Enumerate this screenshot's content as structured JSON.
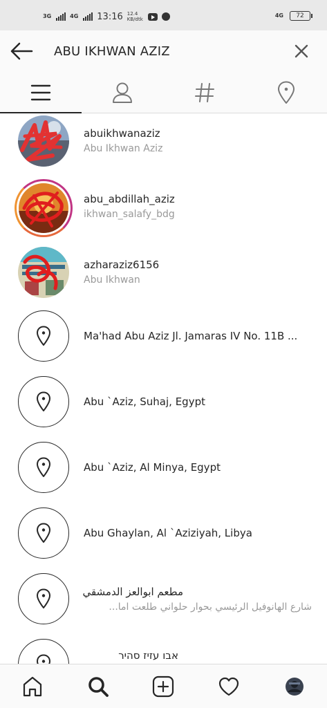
{
  "status_bar": {
    "network_1": "3G",
    "network_2": "4G",
    "time": "13:16",
    "speed": "12.4 KB/dtk",
    "network_right": "4G",
    "battery": "72"
  },
  "search": {
    "query": "ABU IKHWAN AZIZ"
  },
  "tabs": [
    {
      "name": "top",
      "icon": "list-icon"
    },
    {
      "name": "accounts",
      "icon": "person-icon"
    },
    {
      "name": "tags",
      "icon": "hashtag-icon"
    },
    {
      "name": "places",
      "icon": "location-pin-icon"
    }
  ],
  "results": [
    {
      "type": "account",
      "username": "abuikhwanaziz",
      "subtitle": "Abu Ikhwan Aziz"
    },
    {
      "type": "account",
      "username": "abu_abdillah_aziz",
      "subtitle": "ikhwan_salafy_bdg"
    },
    {
      "type": "account",
      "username": "azharaziz6156",
      "subtitle": "Abu Ikhwan"
    },
    {
      "type": "place",
      "name": "Ma'had Abu Aziz Jl. Jamaras IV No. 11B ..."
    },
    {
      "type": "place",
      "name": "Abu `Aziz, Suhaj, Egypt"
    },
    {
      "type": "place",
      "name": "Abu `Aziz, Al Minya, Egypt"
    },
    {
      "type": "place",
      "name": "Abu Ghaylan, Al `Aziziyah, Libya"
    },
    {
      "type": "place",
      "name": "مطعم ابوالعز الدمشقي",
      "subtitle": "شارع الهانوفيل الرئيسي بحوار حلواني طلعت اما..."
    },
    {
      "type": "place",
      "name": "אבו עזיז סהיר"
    }
  ],
  "bottom_nav": [
    "home-icon",
    "search-icon",
    "add-post-icon",
    "heart-icon",
    "profile-avatar"
  ]
}
